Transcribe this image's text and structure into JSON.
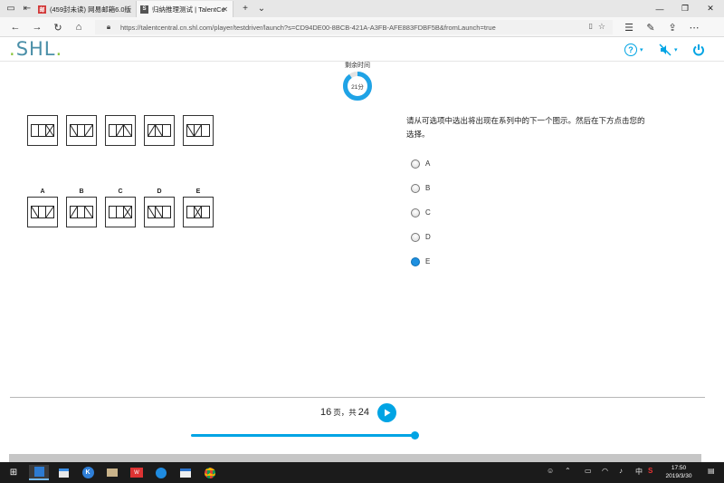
{
  "browser": {
    "tabs": [
      {
        "label": "(459封未读) 网易邮箱6.0版",
        "active": false
      },
      {
        "label": "归纳推理测试 | TalentCe",
        "active": true
      }
    ],
    "url": "https://talentcentral.cn.shl.com/player/testdriver/launch?s=CD94DE00-8BCB-421A-A3FB-AFE883FDBF5B&fromLaunch=true"
  },
  "app": {
    "logo_text": "SHL",
    "logo_dot": "."
  },
  "timer": {
    "label": "剩余时间",
    "value": "21分",
    "fraction_remaining": 0.9
  },
  "question": {
    "instruction": "请从可选项中选出将出现在系列中的下一个图示。然后在下方点击您的选择。",
    "option_letters": [
      "A",
      "B",
      "C",
      "D",
      "E"
    ],
    "answers": [
      {
        "label": "A",
        "checked": false
      },
      {
        "label": "B",
        "checked": false
      },
      {
        "label": "C",
        "checked": false
      },
      {
        "label": "D",
        "checked": false
      },
      {
        "label": "E",
        "checked": true
      }
    ]
  },
  "footer": {
    "page_current": "16",
    "page_sep": "页，共",
    "page_total": "24",
    "progress_fraction": 0.67
  },
  "taskbar": {
    "clock_time": "17:50",
    "clock_date": "2019/3/30",
    "ime": "中"
  },
  "colors": {
    "accent": "#00a4e4",
    "radio_checked": "#1e90e0",
    "logo": "#4a8fa8",
    "logo_dot": "#8cc63f"
  }
}
